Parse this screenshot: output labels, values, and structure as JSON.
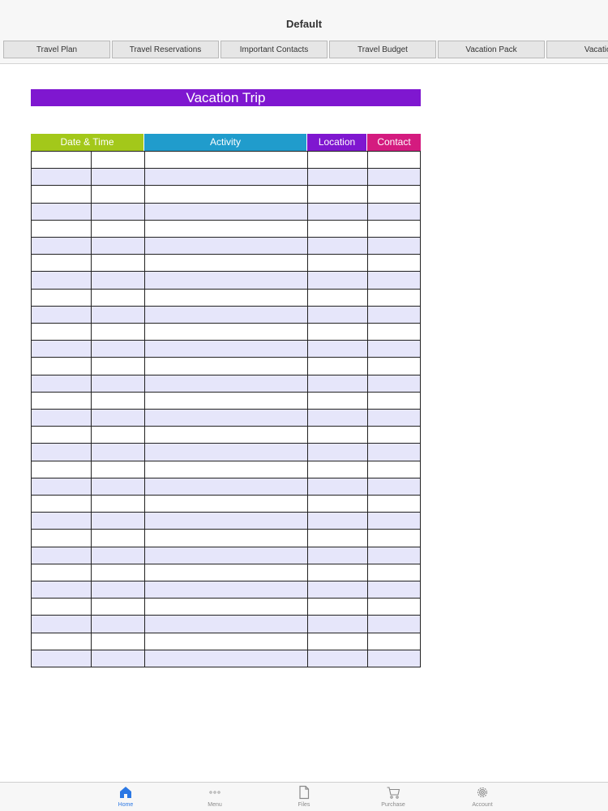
{
  "document": {
    "title": "Default"
  },
  "sheet_tabs": [
    {
      "label": "Travel Plan"
    },
    {
      "label": "Travel Reservations"
    },
    {
      "label": "Important Contacts"
    },
    {
      "label": "Travel Budget"
    },
    {
      "label": "Vacation Pack"
    },
    {
      "label": "Vacation"
    }
  ],
  "sheet": {
    "banner": "Vacation Trip",
    "columns": [
      "Date & Time",
      "Activity",
      "Location",
      "Contact"
    ],
    "row_count": 30,
    "colors": {
      "banner": "#7f17d0",
      "date_time": "#a3c81a",
      "activity": "#209ccc",
      "location": "#7f17d0",
      "contact": "#d41b7f",
      "row_alt": "#e6e6fa"
    }
  },
  "tab_bar": {
    "items": [
      {
        "label": "Home",
        "icon": "home-icon",
        "active": true
      },
      {
        "label": "Menu",
        "icon": "more-dots-icon",
        "active": false
      },
      {
        "label": "Files",
        "icon": "document-icon",
        "active": false
      },
      {
        "label": "Purchase",
        "icon": "cart-icon",
        "active": false
      },
      {
        "label": "Account",
        "icon": "gear-icon",
        "active": false
      }
    ],
    "active_color": "#2b78e4"
  }
}
